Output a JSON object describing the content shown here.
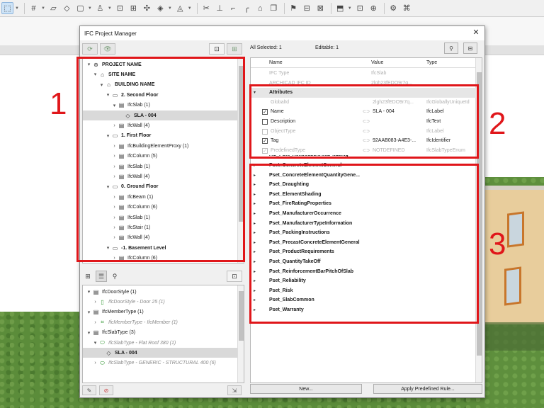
{
  "toolbar": {
    "icons": [
      "pointer-icon",
      "grid-icon",
      "wall-icon",
      "slab-icon",
      "object-icon",
      "lamp-icon",
      "section-icon",
      "layout-icon",
      "favorite-icon",
      "ruler-icon",
      "trace-icon",
      "dimension-icon",
      "flag-icon",
      "window-icon",
      "teamwork-icon",
      "3d-icon",
      "library-icon"
    ]
  },
  "dialog": {
    "title": "IFC Project Manager",
    "tree": [
      {
        "label": "PROJECT NAME",
        "level": 0,
        "bold": true,
        "twisty": "down",
        "icon": "globe-icon"
      },
      {
        "label": "SITE NAME",
        "level": 1,
        "bold": true,
        "twisty": "down",
        "icon": "site-icon"
      },
      {
        "label": "BUILDING NAME",
        "level": 2,
        "bold": true,
        "twisty": "down",
        "icon": "building-icon"
      },
      {
        "label": "2. Second Floor",
        "level": 3,
        "bold": true,
        "twisty": "down",
        "icon": "folder-icon"
      },
      {
        "label": "IfcSlab (1)",
        "level": 4,
        "bold": false,
        "twisty": "down",
        "icon": "type-icon"
      },
      {
        "label": "SLA - 004",
        "level": 5,
        "bold": true,
        "twisty": "",
        "icon": "element-icon",
        "selected": true
      },
      {
        "label": "IfcWall (4)",
        "level": 4,
        "bold": false,
        "twisty": "right",
        "icon": "type-icon"
      },
      {
        "label": "1. First Floor",
        "level": 3,
        "bold": true,
        "twisty": "down",
        "icon": "folder-icon"
      },
      {
        "label": "IfcBuildingElementProxy (1)",
        "level": 4,
        "bold": false,
        "twisty": "right",
        "icon": "type-icon"
      },
      {
        "label": "IfcColumn (5)",
        "level": 4,
        "bold": false,
        "twisty": "right",
        "icon": "type-icon"
      },
      {
        "label": "IfcSlab (1)",
        "level": 4,
        "bold": false,
        "twisty": "right",
        "icon": "type-icon"
      },
      {
        "label": "IfcWall (4)",
        "level": 4,
        "bold": false,
        "twisty": "right",
        "icon": "type-icon"
      },
      {
        "label": "0. Ground Floor",
        "level": 3,
        "bold": true,
        "twisty": "down",
        "icon": "folder-icon"
      },
      {
        "label": "IfcBeam (1)",
        "level": 4,
        "bold": false,
        "twisty": "right",
        "icon": "type-icon"
      },
      {
        "label": "IfcColumn (6)",
        "level": 4,
        "bold": false,
        "twisty": "right",
        "icon": "type-icon"
      },
      {
        "label": "IfcSlab (1)",
        "level": 4,
        "bold": false,
        "twisty": "right",
        "icon": "type-icon"
      },
      {
        "label": "IfcStair (1)",
        "level": 4,
        "bold": false,
        "twisty": "right",
        "icon": "type-icon"
      },
      {
        "label": "IfcWall (4)",
        "level": 4,
        "bold": false,
        "twisty": "right",
        "icon": "type-icon"
      },
      {
        "label": "-1. Basement Level",
        "level": 3,
        "bold": true,
        "twisty": "down",
        "icon": "folder-icon"
      },
      {
        "label": "IfcColumn (6)",
        "level": 4,
        "bold": false,
        "twisty": "right",
        "icon": "type-icon"
      }
    ],
    "type_tree": [
      {
        "label": "IfcDoorStyle (1)",
        "level": 0,
        "twisty": "down",
        "style": "normal",
        "icon": "type-icon"
      },
      {
        "label": "IfcDoorStyle - Door 25 (1)",
        "level": 1,
        "twisty": "right",
        "style": "italic",
        "icon": "door-icon"
      },
      {
        "label": "IfcMemberType (1)",
        "level": 0,
        "twisty": "down",
        "style": "normal",
        "icon": "type-icon"
      },
      {
        "label": "IfcMemberType - IfcMember (1)",
        "level": 1,
        "twisty": "right",
        "style": "italic",
        "icon": "member-icon"
      },
      {
        "label": "IfcSlabType (3)",
        "level": 0,
        "twisty": "down",
        "style": "normal",
        "icon": "type-icon"
      },
      {
        "label": "IfcSlabType - Flat Roof 380 (1)",
        "level": 1,
        "twisty": "down",
        "style": "italic",
        "icon": "slabtype-icon"
      },
      {
        "label": "SLA - 004",
        "level": 2,
        "twisty": "",
        "style": "bold",
        "icon": "element-icon",
        "selected": true
      },
      {
        "label": "IfcSlabType - GENERIC - STRUCTURAL 400 (6)",
        "level": 1,
        "twisty": "right",
        "style": "italic",
        "icon": "slabtype-icon"
      }
    ],
    "selection": {
      "all_selected": "All Selected: 1",
      "editable": "Editable: 1"
    },
    "columns": {
      "name": "Name",
      "value": "Value",
      "type": "Type"
    },
    "props_top": [
      {
        "name": "IFC Type",
        "value": "IfcSlab",
        "type": ""
      },
      {
        "name": "ARCHICAD IFC ID",
        "value": "2lgh23fEDO9r7q...",
        "type": ""
      }
    ],
    "attributes_label": "Attributes",
    "attributes": [
      {
        "name": "GlobalId",
        "value": "2lgh23fEDO9r7q...",
        "type": "IfcGloballyUniqueId",
        "check": "none",
        "enabled": false
      },
      {
        "name": "Name",
        "value": "SLA - 004",
        "type": "IfcLabel",
        "check": "checked",
        "enabled": true
      },
      {
        "name": "Description",
        "value": "",
        "type": "IfcText",
        "check": "empty",
        "enabled": true
      },
      {
        "name": "ObjectType",
        "value": "",
        "type": "IfcLabel",
        "check": "empty-disabled",
        "enabled": false
      },
      {
        "name": "Tag",
        "value": "92AAB083-A4E3-...",
        "type": "IfcIdentifier",
        "check": "checked",
        "enabled": true
      },
      {
        "name": "PredefinedType",
        "value": "NOTDEFINED",
        "type": "IfcSlabTypeEnum",
        "check": "checked-disabled",
        "enabled": false
      }
    ],
    "partial_pset": "AC_Pset_RenovationAndPhasing",
    "psets": [
      "Pset_ConcreteElementGeneral",
      "Pset_ConcreteElementQuantityGene...",
      "Pset_Draughting",
      "Pset_ElementShading",
      "Pset_FireRatingProperties",
      "Pset_ManufacturerOccurrence",
      "Pset_ManufacturerTypeInformation",
      "Pset_PackingInstructions",
      "Pset_PrecastConcreteElementGeneral",
      "Pset_ProductRequirements",
      "Pset_QuantityTakeOff",
      "Pset_ReinforcementBarPitchOfSlab",
      "Pset_Reliability",
      "Pset_Risk",
      "Pset_SlabCommon",
      "Pset_Warranty"
    ],
    "buttons": {
      "new": "New...",
      "apply": "Apply Predefined Rule..."
    }
  },
  "annotations": [
    "1",
    "2",
    "3"
  ],
  "colors": {
    "annotation_red": "#e0161a",
    "selection_grey": "#d9d9d9"
  }
}
